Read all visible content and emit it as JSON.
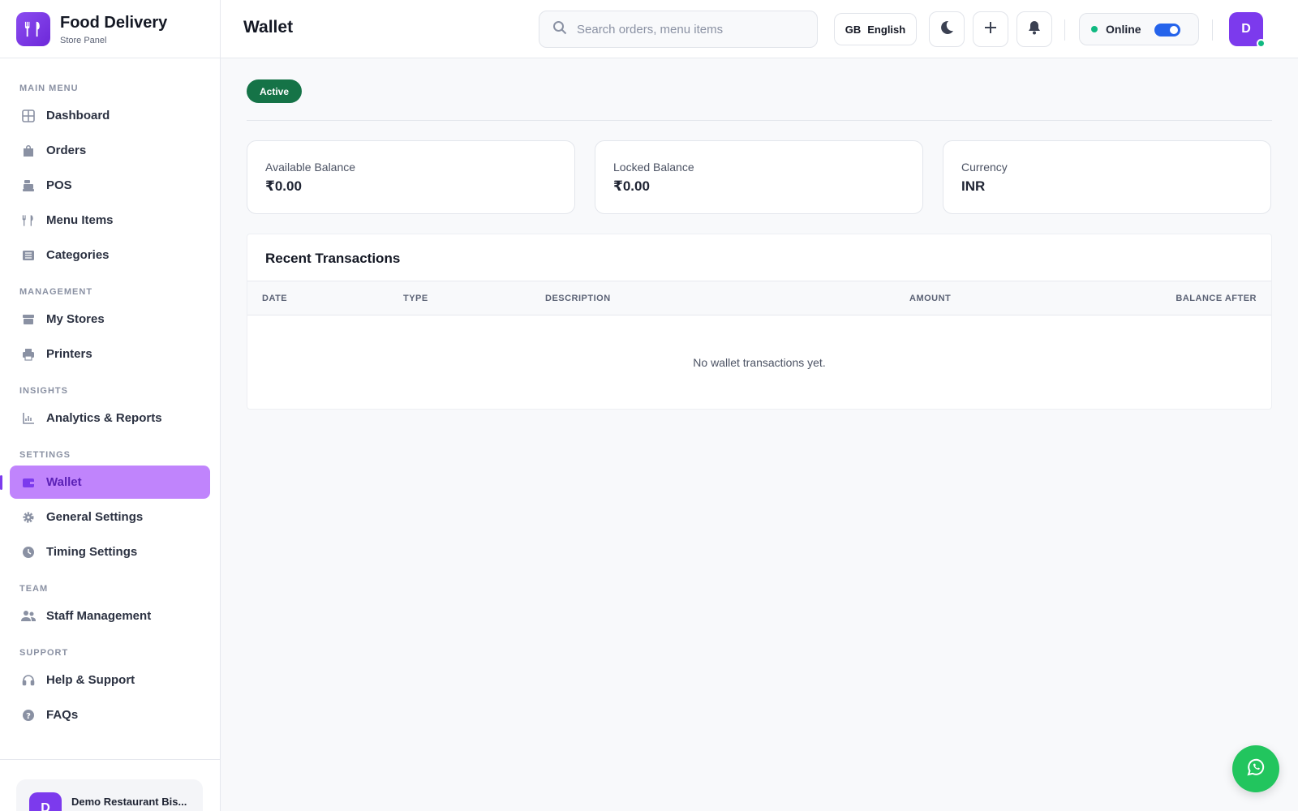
{
  "brand": {
    "title": "Food Delivery",
    "subtitle": "Store Panel"
  },
  "nav": {
    "main_menu": "MAIN MENU",
    "dashboard": "Dashboard",
    "orders": "Orders",
    "pos": "POS",
    "menu_items": "Menu Items",
    "categories": "Categories",
    "management": "MANAGEMENT",
    "my_stores": "My Stores",
    "printers": "Printers",
    "insights": "INSIGHTS",
    "analytics": "Analytics & Reports",
    "settings": "SETTINGS",
    "wallet": "Wallet",
    "general_settings": "General Settings",
    "timing_settings": "Timing Settings",
    "team": "TEAM",
    "staff": "Staff Management",
    "support": "SUPPORT",
    "help": "Help & Support",
    "faqs": "FAQs"
  },
  "profile": {
    "initial": "D",
    "name": "Demo Restaurant Bis..."
  },
  "header": {
    "title": "Wallet",
    "search_placeholder": "Search orders, menu items",
    "lang_code": "GB",
    "lang_name": "English",
    "status": "Online",
    "user_initial": "D"
  },
  "wallet": {
    "status_badge": "Active",
    "available_label": "Available Balance",
    "available_value": "₹0.00",
    "locked_label": "Locked Balance",
    "locked_value": "₹0.00",
    "currency_label": "Currency",
    "currency_value": "INR"
  },
  "transactions": {
    "title": "Recent Transactions",
    "columns": [
      "DATE",
      "TYPE",
      "DESCRIPTION",
      "AMOUNT",
      "BALANCE AFTER"
    ],
    "empty_text": "No wallet transactions yet."
  },
  "colors": {
    "accent": "#7c3aed",
    "active_nav_bg": "#c084fc",
    "badge": "#157347",
    "online": "#10b981",
    "whatsapp": "#22c55e"
  }
}
